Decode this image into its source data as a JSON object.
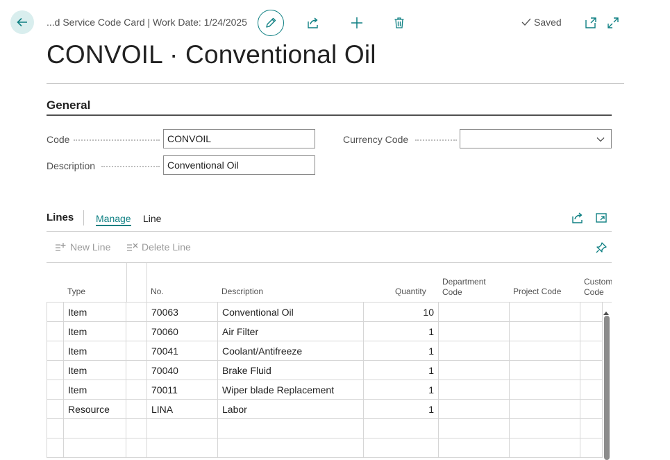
{
  "header": {
    "breadcrumb": "...d Service Code Card | Work Date: 1/24/2025",
    "saved_label": "Saved"
  },
  "page": {
    "title": "CONVOIL · Conventional Oil"
  },
  "general": {
    "heading": "General",
    "code_label": "Code",
    "code_value": "CONVOIL",
    "description_label": "Description",
    "description_value": "Conventional Oil",
    "currency_label": "Currency Code",
    "currency_value": ""
  },
  "lines": {
    "heading": "Lines",
    "tabs": [
      "Manage",
      "Line"
    ],
    "actions": [
      "New Line",
      "Delete Line"
    ],
    "columns": [
      "Type",
      "No.",
      "Description",
      "Quantity",
      "Department Code",
      "Project Code",
      "Custom Code"
    ],
    "column_display": {
      "type": "Type",
      "no": "No.",
      "description": "Description",
      "quantity": "Quantity",
      "department_1": "Department",
      "department_2": "Code",
      "project": "Project Code",
      "custom_1": "Custom",
      "custom_2": "Code"
    },
    "rows": [
      {
        "type": "Item",
        "no": "70063",
        "description": "Conventional Oil",
        "quantity": "10"
      },
      {
        "type": "Item",
        "no": "70060",
        "description": "Air Filter",
        "quantity": "1"
      },
      {
        "type": "Item",
        "no": "70041",
        "description": "Coolant/Antifreeze",
        "quantity": "1"
      },
      {
        "type": "Item",
        "no": "70040",
        "description": "Brake Fluid",
        "quantity": "1"
      },
      {
        "type": "Item",
        "no": "70011",
        "description": "Wiper blade Replacement",
        "quantity": "1"
      },
      {
        "type": "Resource",
        "no": "LINA",
        "description": "Labor",
        "quantity": "1"
      },
      {
        "type": "",
        "no": "",
        "description": "",
        "quantity": ""
      },
      {
        "type": "",
        "no": "",
        "description": "",
        "quantity": ""
      }
    ]
  },
  "colors": {
    "accent": "#0d7f82",
    "back_button_bg": "#d9eeee"
  },
  "icons": [
    "back-arrow-icon",
    "pencil-icon",
    "share-icon",
    "plus-icon",
    "trash-icon",
    "checkmark-icon",
    "open-new-window-icon",
    "expand-icon",
    "chevron-down-icon",
    "new-line-icon",
    "delete-line-icon",
    "pin-icon"
  ]
}
